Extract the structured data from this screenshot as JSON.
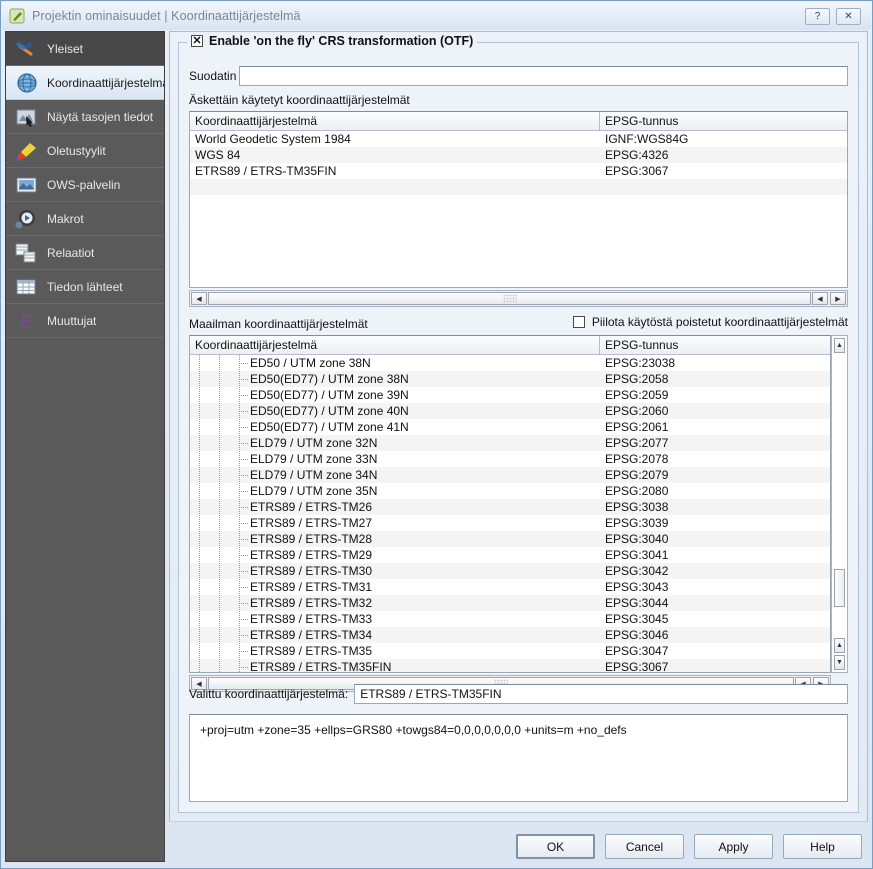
{
  "window": {
    "title": "Projektin ominaisuudet | Koordinaattijärjestelmä",
    "icon": "qgis-pencil-icon",
    "help_button": "?",
    "close_button": "✕"
  },
  "sidebar": {
    "items": [
      {
        "label": "Yleiset",
        "icon": "hammer-icon",
        "state": "hover"
      },
      {
        "label": "Koordinaattijärjestelmä",
        "icon": "globe-icon",
        "state": "selected"
      },
      {
        "label": "Näytä tasojen tiedot",
        "icon": "identify-icon",
        "state": "normal"
      },
      {
        "label": "Oletustyylit",
        "icon": "paintbrush-icon",
        "state": "normal"
      },
      {
        "label": "OWS-palvelin",
        "icon": "ows-server-icon",
        "state": "normal"
      },
      {
        "label": "Makrot",
        "icon": "macro-gear-icon",
        "state": "normal"
      },
      {
        "label": "Relaatiot",
        "icon": "relations-icon",
        "state": "normal"
      },
      {
        "label": "Tiedon lähteet",
        "icon": "datasources-grid-icon",
        "state": "normal"
      },
      {
        "label": "Muuttujat",
        "icon": "variables-icon",
        "state": "normal"
      }
    ]
  },
  "otf": {
    "label": "Enable 'on the fly' CRS transformation (OTF)",
    "checked": true
  },
  "filter": {
    "label": "Suodatin",
    "value": "",
    "placeholder": ""
  },
  "recent": {
    "section_label": "Äskettäin käytetyt koordinaattijärjestelmät",
    "columns": [
      "Koordinaattijärjestelmä",
      "EPSG-tunnus"
    ],
    "rows": [
      {
        "name": "World Geodetic System 1984",
        "code": "IGNF:WGS84G"
      },
      {
        "name": "WGS 84",
        "code": "EPSG:4326"
      },
      {
        "name": "ETRS89 / ETRS-TM35FIN",
        "code": "EPSG:3067"
      }
    ]
  },
  "world": {
    "section_label": "Maailman koordinaattijärjestelmät",
    "hide_deprecated": {
      "label": "Piilota käytöstä poistetut koordinaattijärjestelmät",
      "checked": false
    },
    "columns": [
      "Koordinaattijärjestelmä",
      "EPSG-tunnus"
    ],
    "rows": [
      {
        "name": "ED50 / UTM zone 38N",
        "code": "EPSG:23038"
      },
      {
        "name": "ED50(ED77) / UTM zone 38N",
        "code": "EPSG:2058"
      },
      {
        "name": "ED50(ED77) / UTM zone 39N",
        "code": "EPSG:2059"
      },
      {
        "name": "ED50(ED77) / UTM zone 40N",
        "code": "EPSG:2060"
      },
      {
        "name": "ED50(ED77) / UTM zone 41N",
        "code": "EPSG:2061"
      },
      {
        "name": "ELD79 / UTM zone 32N",
        "code": "EPSG:2077"
      },
      {
        "name": "ELD79 / UTM zone 33N",
        "code": "EPSG:2078"
      },
      {
        "name": "ELD79 / UTM zone 34N",
        "code": "EPSG:2079"
      },
      {
        "name": "ELD79 / UTM zone 35N",
        "code": "EPSG:2080"
      },
      {
        "name": "ETRS89 / ETRS-TM26",
        "code": "EPSG:3038"
      },
      {
        "name": "ETRS89 / ETRS-TM27",
        "code": "EPSG:3039"
      },
      {
        "name": "ETRS89 / ETRS-TM28",
        "code": "EPSG:3040"
      },
      {
        "name": "ETRS89 / ETRS-TM29",
        "code": "EPSG:3041"
      },
      {
        "name": "ETRS89 / ETRS-TM30",
        "code": "EPSG:3042"
      },
      {
        "name": "ETRS89 / ETRS-TM31",
        "code": "EPSG:3043"
      },
      {
        "name": "ETRS89 / ETRS-TM32",
        "code": "EPSG:3044"
      },
      {
        "name": "ETRS89 / ETRS-TM33",
        "code": "EPSG:3045"
      },
      {
        "name": "ETRS89 / ETRS-TM34",
        "code": "EPSG:3046"
      },
      {
        "name": "ETRS89 / ETRS-TM35",
        "code": "EPSG:3047"
      },
      {
        "name": "ETRS89 / ETRS-TM35FIN",
        "code": "EPSG:3067"
      }
    ]
  },
  "selected_crs": {
    "label": "Valittu koordinaattijärjestelmä:",
    "value": "ETRS89 / ETRS-TM35FIN"
  },
  "proj4": {
    "text": "+proj=utm +zone=35 +ellps=GRS80 +towgs84=0,0,0,0,0,0,0 +units=m +no_defs"
  },
  "buttons": {
    "ok": "OK",
    "cancel": "Cancel",
    "apply": "Apply",
    "help": "Help"
  },
  "scroll_icons": {
    "left": "◀",
    "right": "▶",
    "up": "▲",
    "down": "▼"
  },
  "colors": {
    "sidebar_bg": "#5a5a5a",
    "titlebar": "#e3ecf6",
    "panel_bg": "#eaf1f8",
    "list_bg": "#ffffff",
    "alt_row": "#f4f4f4",
    "frame": "#7a9ec2"
  }
}
